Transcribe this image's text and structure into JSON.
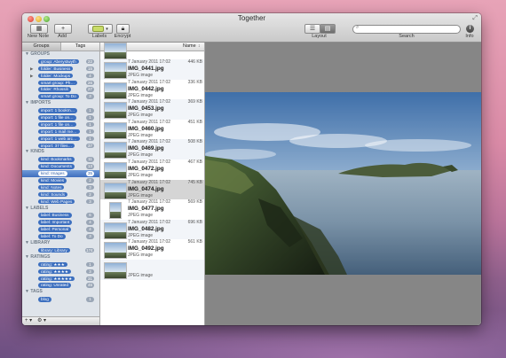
{
  "window": {
    "title": "Together"
  },
  "toolbar": {
    "new_note": "New Note",
    "add": "Add",
    "labels": "Labels",
    "encrypt": "Encrypt",
    "layout": "Layout",
    "search": "Search",
    "search_placeholder": "",
    "info": "Info",
    "label_color": "#c9dc6a"
  },
  "sidebar": {
    "tabs": [
      "Groups",
      "Tags"
    ],
    "rows": [
      {
        "type": "section",
        "label": "▼ GROUPS"
      },
      {
        "type": "item",
        "label": "group: Aberystwyth",
        "count": "22",
        "disclosure": ""
      },
      {
        "type": "item",
        "label": "folder: Business",
        "count": "15",
        "disclosure": "▶"
      },
      {
        "type": "item",
        "label": "folder: Mockups",
        "count": "4",
        "disclosure": "▶"
      },
      {
        "type": "item",
        "label": "smart group: Ph…",
        "count": "26",
        "disclosure": ""
      },
      {
        "type": "item",
        "label": "folder: Rhossili",
        "count": "27",
        "disclosure": ""
      },
      {
        "type": "item",
        "label": "smart group: To Do",
        "count": "3",
        "disclosure": ""
      },
      {
        "type": "section",
        "label": "▼ IMPORTS"
      },
      {
        "type": "item",
        "label": "import: 1 bookm…",
        "count": "1",
        "disclosure": ""
      },
      {
        "type": "item",
        "label": "import: 1 file on…",
        "count": "1",
        "disclosure": ""
      },
      {
        "type": "item",
        "label": "import: 1 file on…",
        "count": "1",
        "disclosure": ""
      },
      {
        "type": "item",
        "label": "import: 1 mail me…",
        "count": "1",
        "disclosure": ""
      },
      {
        "type": "item",
        "label": "import: 1 web arc…",
        "count": "1",
        "disclosure": ""
      },
      {
        "type": "item",
        "label": "import: 37 files…",
        "count": "37",
        "disclosure": ""
      },
      {
        "type": "section",
        "label": "▼ KINDS"
      },
      {
        "type": "item",
        "label": "kind: Bookmarks",
        "count": "11",
        "disclosure": ""
      },
      {
        "type": "item",
        "label": "kind: Documents",
        "count": "13",
        "disclosure": ""
      },
      {
        "type": "item",
        "label": "kind: Images",
        "count": "35",
        "disclosure": "",
        "selected": true
      },
      {
        "type": "item",
        "label": "kind: Movies",
        "count": "2",
        "disclosure": ""
      },
      {
        "type": "item",
        "label": "kind: Notes",
        "count": "3",
        "disclosure": ""
      },
      {
        "type": "item",
        "label": "kind: Sounds",
        "count": "2",
        "disclosure": ""
      },
      {
        "type": "item",
        "label": "kind: Web Pages",
        "count": "3",
        "disclosure": ""
      },
      {
        "type": "section",
        "label": "▼ LABELS"
      },
      {
        "type": "item",
        "label": "label: Business",
        "count": "6",
        "disclosure": ""
      },
      {
        "type": "item",
        "label": "label: Important",
        "count": "4",
        "disclosure": ""
      },
      {
        "type": "item",
        "label": "label: Personal",
        "count": "4",
        "disclosure": ""
      },
      {
        "type": "item",
        "label": "label: To Do",
        "count": "3",
        "disclosure": ""
      },
      {
        "type": "section",
        "label": "▼ LIBRARY"
      },
      {
        "type": "item",
        "label": "library: Library",
        "count": "174",
        "disclosure": ""
      },
      {
        "type": "section",
        "label": "▼ RATINGS"
      },
      {
        "type": "item",
        "label": "rating: ★★★",
        "count": "1",
        "disclosure": ""
      },
      {
        "type": "item",
        "label": "rating: ★★★★",
        "count": "3",
        "disclosure": ""
      },
      {
        "type": "item",
        "label": "rating: ★★★★★",
        "count": "31",
        "disclosure": ""
      },
      {
        "type": "item",
        "label": "rating: Unrated",
        "count": "45",
        "disclosure": ""
      },
      {
        "type": "section",
        "label": "▼ TAGS"
      },
      {
        "type": "item",
        "label": "blog",
        "count": "1",
        "disclosure": ""
      }
    ],
    "bottom_add": "+ ▾",
    "bottom_gear": "⚙ ▾"
  },
  "list": {
    "column_name": "Name",
    "sort_icon": "↕",
    "items": [
      {
        "date": "",
        "name": "",
        "type": "",
        "size": "",
        "thumb": "landscape",
        "partial": true
      },
      {
        "date": "7 January 2011 17:02",
        "name": "IMG_0441.jpg",
        "type": "JPEG image",
        "size": "446 KB",
        "thumb": "landscape"
      },
      {
        "date": "7 January 2011 17:02",
        "name": "IMG_0442.jpg",
        "type": "JPEG image",
        "size": "336 KB",
        "thumb": "landscape"
      },
      {
        "date": "7 January 2011 17:02",
        "name": "IMG_0453.jpg",
        "type": "JPEG image",
        "size": "369 KB",
        "thumb": "landscape"
      },
      {
        "date": "7 January 2011 17:02",
        "name": "IMG_0460.jpg",
        "type": "JPEG image",
        "size": "451 KB",
        "thumb": "landscape"
      },
      {
        "date": "7 January 2011 17:02",
        "name": "IMG_0469.jpg",
        "type": "JPEG image",
        "size": "508 KB",
        "thumb": "landscape"
      },
      {
        "date": "7 January 2011 17:02",
        "name": "IMG_0472.jpg",
        "type": "JPEG image",
        "size": "467 KB",
        "thumb": "landscape"
      },
      {
        "date": "7 January 2011 17:02",
        "name": "IMG_0474.jpg",
        "type": "JPEG image",
        "size": "745 KB",
        "thumb": "landscape",
        "selected": true
      },
      {
        "date": "7 January 2011 17:02",
        "name": "IMG_0477.jpg",
        "type": "JPEG image",
        "size": "569 KB",
        "thumb": "portrait"
      },
      {
        "date": "7 January 2011 17:02",
        "name": "IMG_0482.jpg",
        "type": "JPEG image",
        "size": "696 KB",
        "thumb": "landscape"
      },
      {
        "date": "7 January 2011 17:02",
        "name": "IMG_0492.jpg",
        "type": "JPEG image",
        "size": "561 KB",
        "thumb": "landscape"
      },
      {
        "date": "",
        "name": "",
        "type": "JPEG image",
        "size": "",
        "thumb": "landscape"
      }
    ]
  }
}
